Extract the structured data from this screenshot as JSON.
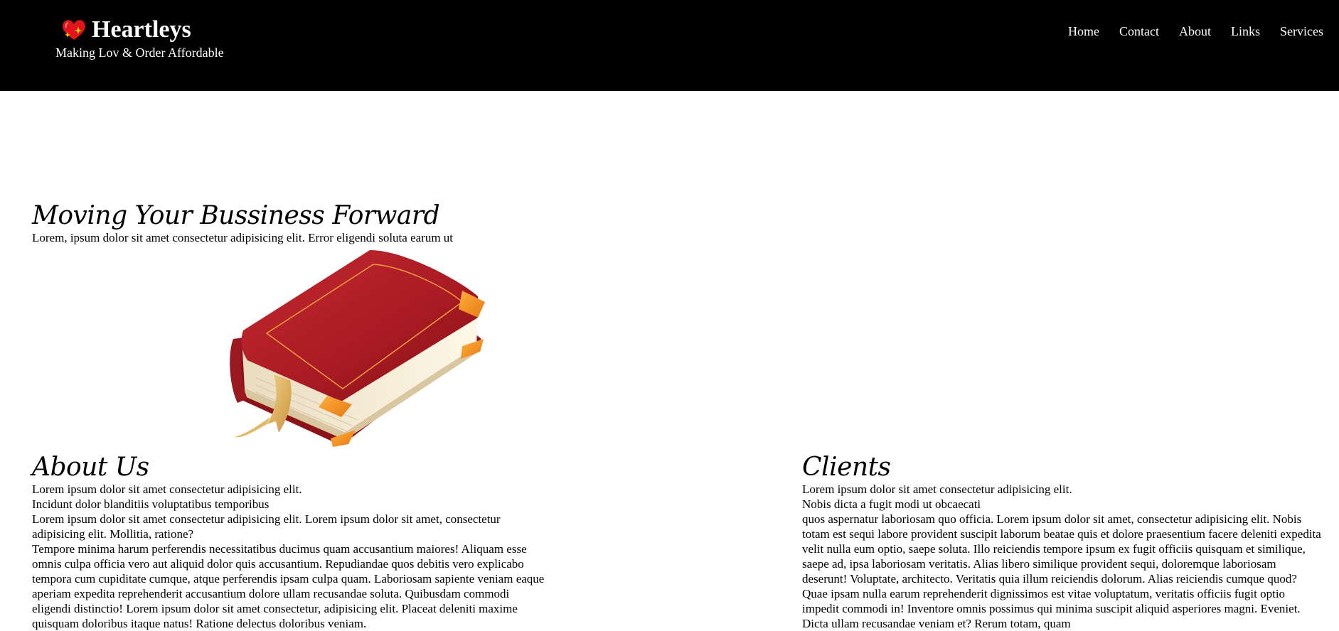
{
  "header": {
    "brand_name": "Heartleys",
    "tagline": "Making Lov & Order Affordable",
    "logo_icon": "heart-sparkle-icon",
    "nav": [
      "Home",
      "Contact",
      "About",
      "Links",
      "Services"
    ]
  },
  "hero": {
    "title": "Moving Your Bussiness Forward",
    "text": "Lorem, ipsum dolor sit amet consectetur adipisicing elit. Error eligendi soluta earum ut",
    "image_icon": "book-icon"
  },
  "about": {
    "title": "About Us",
    "lines": [
      "Lorem ipsum dolor sit amet consectetur adipisicing elit.",
      "Incidunt dolor blanditiis voluptatibus temporibus",
      "Lorem ipsum dolor sit amet consectetur adipisicing elit. Lorem ipsum dolor sit amet, consectetur adipisicing elit. Mollitia, ratione?",
      "Tempore minima harum perferendis necessitatibus ducimus quam accusantium maiores! Aliquam esse omnis culpa officia vero aut aliquid dolor quis accusantium. Repudiandae quos debitis vero explicabo tempora cum cupiditate cumque, atque perferendis ipsam culpa quam. Laboriosam sapiente veniam eaque aperiam expedita reprehenderit accusantium dolore ullam recusandae soluta. Quibusdam commodi eligendi distinctio! Lorem ipsum dolor sit amet consectetur, adipisicing elit. Placeat deleniti maxime quisquam doloribus itaque natus! Ratione delectus doloribus veniam."
    ]
  },
  "clients": {
    "title": "Clients",
    "lines": [
      "Lorem ipsum dolor sit amet consectetur adipisicing elit.",
      "Nobis dicta a fugit modi ut obcaecati",
      "quos aspernatur laboriosam quo officia. Lorem ipsum dolor sit amet, consectetur adipisicing elit. Nobis totam est sequi labore provident suscipit laborum beatae quis et dolore praesentium facere deleniti expedita velit nulla eum optio, saepe soluta. Illo reiciendis tempore ipsum ex fugit officiis quisquam et similique, saepe ad, ipsa laboriosam veritatis. Alias libero similique provident sequi, doloremque laboriosam deserunt! Voluptate, architecto. Veritatis quia illum reiciendis dolorum. Alias reiciendis cumque quod? Quae ipsam nulla earum reprehenderit dignissimos est vitae voluptatum, veritatis officiis fugit optio impedit commodi in! Inventore omnis possimus qui minima suscipit aliquid asperiores magni. Eveniet. Dicta ullam recusandae veniam et? Rerum totam, quam"
    ]
  }
}
